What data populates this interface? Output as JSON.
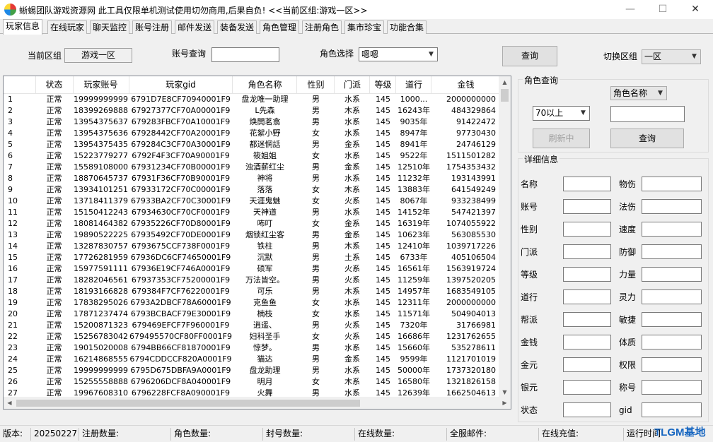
{
  "window": {
    "title": "蜥蜴团队游戏资源网 此工具仅限单机测试使用切勿商用,后果自负! <<当前区组:游戏一区>>",
    "minimize": "—",
    "maximize": "☐",
    "close": "✕"
  },
  "tabs": [
    "玩家信息",
    "在线玩家",
    "聊天监控",
    "账号注册",
    "邮件发送",
    "装备发送",
    "角色管理",
    "注册角色",
    "集市珍宝",
    "功能合集"
  ],
  "toolbar": {
    "current_zone_label": "当前区组",
    "current_zone_value": "游戏一区",
    "account_query_label": "账号查询",
    "account_query_value": "",
    "role_select_label": "角色选择",
    "role_select_value": "嗯嗯",
    "query_button": "查询",
    "switch_zone_label": "切换区组",
    "switch_zone_value": "一区"
  },
  "grid": {
    "columns": [
      "",
      "状态",
      "玩家账号",
      "玩家gid",
      "角色名称",
      "性别",
      "门派",
      "等级",
      "道行",
      "金钱"
    ],
    "rows": [
      [
        "1",
        "正常",
        "19999999999",
        "6791D7E8CF70940001F9",
        "盘龙唯一助理",
        "男",
        "水系",
        "145",
        "1000...",
        "2000000000"
      ],
      [
        "2",
        "正常",
        "18399269888",
        "67927377CF70A00001F9",
        "L先森",
        "男",
        "木系",
        "145",
        "16243年",
        "484329864"
      ],
      [
        "3",
        "正常",
        "13954375637",
        "679283FBCF70A10001F9",
        "焕閧茗翕",
        "男",
        "水系",
        "145",
        "9035年",
        "91422472"
      ],
      [
        "4",
        "正常",
        "13954375636",
        "67928442CF70A20001F9",
        "花絮小野",
        "女",
        "水系",
        "145",
        "8947年",
        "97730430"
      ],
      [
        "5",
        "正常",
        "13954375435",
        "679284C3CF70A30001F9",
        "都迷惘話",
        "男",
        "金系",
        "145",
        "8941年",
        "24746129"
      ],
      [
        "6",
        "正常",
        "15223779277",
        "6792F4F3CF70A90001F9",
        "筱姐姐",
        "女",
        "水系",
        "145",
        "9522年",
        "1511501282"
      ],
      [
        "7",
        "正常",
        "15589108000",
        "67931234CF70B00001F9",
        "浊酒薪红尘",
        "男",
        "金系",
        "145",
        "12510年",
        "1754353432"
      ],
      [
        "8",
        "正常",
        "18870645737",
        "67931F36CF70B90001F9",
        "神将",
        "男",
        "水系",
        "145",
        "11232年",
        "193143991"
      ],
      [
        "9",
        "正常",
        "13934101251",
        "67933172CF70C00001F9",
        "落落",
        "女",
        "木系",
        "145",
        "13883年",
        "641549249"
      ],
      [
        "10",
        "正常",
        "13718411379",
        "67933BA2CF70C30001F9",
        "天涯鬼魅",
        "女",
        "火系",
        "145",
        "8067年",
        "933238499"
      ],
      [
        "11",
        "正常",
        "15150412243",
        "67934630CF70CF0001F9",
        "天神道",
        "男",
        "水系",
        "145",
        "14152年",
        "547421397"
      ],
      [
        "12",
        "正常",
        "18081464382",
        "67935226CF70D80001F9",
        "咘叮",
        "女",
        "金系",
        "145",
        "16319年",
        "1074055922"
      ],
      [
        "13",
        "正常",
        "19890522225",
        "67935492CF70DE0001F9",
        "烟锁红尘客",
        "男",
        "金系",
        "145",
        "10623年",
        "563085530"
      ],
      [
        "14",
        "正常",
        "13287830757",
        "6793675CCF738F0001F9",
        "铁柱",
        "男",
        "木系",
        "145",
        "12410年",
        "1039717226"
      ],
      [
        "15",
        "正常",
        "17726281959",
        "67936DC6CF74650001F9",
        "沉默",
        "男",
        "土系",
        "145",
        "6733年",
        "405106504"
      ],
      [
        "16",
        "正常",
        "15977591111",
        "67936E19CF746A0001F9",
        "硕军",
        "男",
        "火系",
        "145",
        "16561年",
        "1563919724"
      ],
      [
        "17",
        "正常",
        "18282046561",
        "67937353CF75200001F9",
        "万法皆空。",
        "男",
        "火系",
        "145",
        "11259年",
        "1397520205"
      ],
      [
        "18",
        "正常",
        "18193166828",
        "679384F7CF76220001F9",
        "可乐",
        "男",
        "木系",
        "145",
        "14957年",
        "1683549105"
      ],
      [
        "19",
        "正常",
        "17838295026",
        "6793A2DBCF78A60001F9",
        "克鱼鱼",
        "女",
        "水系",
        "145",
        "12311年",
        "2000000000"
      ],
      [
        "20",
        "正常",
        "17871237474",
        "6793BCBACF79E30001F9",
        "楠枝",
        "女",
        "水系",
        "145",
        "11571年",
        "504904013"
      ],
      [
        "21",
        "正常",
        "15200871323",
        "679469EFCF7F960001F9",
        "逍遥、",
        "男",
        "火系",
        "145",
        "7320年",
        "31766981"
      ],
      [
        "22",
        "正常",
        "15256783042",
        "679495570CF80FF0001F9",
        "妇科圣手",
        "女",
        "火系",
        "145",
        "16686年",
        "1231762655"
      ],
      [
        "23",
        "正常",
        "19015020008",
        "6794BB66CF81870001F9",
        "惊梦。",
        "男",
        "水系",
        "145",
        "15660年",
        "535278611"
      ],
      [
        "24",
        "正常",
        "16214868555",
        "6794CDDCCF820A0001F9",
        "猫达",
        "男",
        "金系",
        "145",
        "9599年",
        "1121701019"
      ],
      [
        "25",
        "正常",
        "19999999999",
        "6795D675DBFA9A0001F9",
        "盘龙助理",
        "男",
        "水系",
        "145",
        "50000年",
        "1737320180"
      ],
      [
        "26",
        "正常",
        "15255558888",
        "6796206DCF8A040001F9",
        "明月",
        "女",
        "木系",
        "145",
        "16580年",
        "1321826158"
      ],
      [
        "27",
        "正常",
        "19967608310",
        "6796228FCF8A090001F9",
        "火舞",
        "男",
        "水系",
        "145",
        "12639年",
        "1662504613"
      ]
    ]
  },
  "role_query": {
    "title": "角色查询",
    "field_select": "角色名称",
    "level_select": "70以上",
    "input_value": "",
    "refresh_button": "刷新中",
    "query_button": "查询"
  },
  "detail": {
    "title": "详细信息",
    "left_labels": [
      "名称",
      "账号",
      "性别",
      "门派",
      "等级",
      "道行",
      "帮派",
      "金钱",
      "金元",
      "银元",
      "状态"
    ],
    "right_labels": [
      "物伤",
      "法伤",
      "速度",
      "防御",
      "力量",
      "灵力",
      "敏捷",
      "体质",
      "权限",
      "称号",
      "gid"
    ]
  },
  "statusbar": {
    "version_label": "版本:",
    "version_value": "20250227",
    "register_count": "注册数量:",
    "role_count": "角色数量:",
    "ban_count": "封号数量:",
    "online_count": "在线数量:",
    "server_mail": "全服邮件:",
    "online_recharge": "在线充值:",
    "run_time": "运行时间"
  },
  "watermark": "TLGM基地"
}
